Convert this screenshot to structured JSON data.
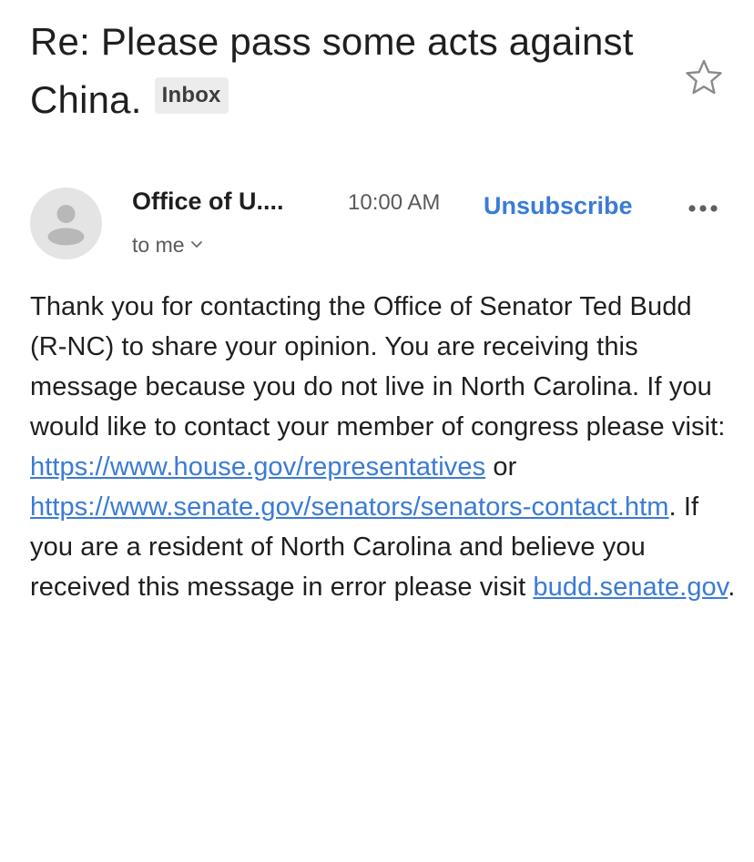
{
  "email": {
    "subject": "Re: Please pass some acts against China.",
    "label": "Inbox",
    "sender": "Office of U....",
    "time": "10:00 AM",
    "unsubscribe": "Unsubscribe",
    "recipient": "to me",
    "body": {
      "part1": "Thank you for contacting the Office of Senator Ted Budd (R-NC) to share your opinion. You are receiving this message because you do not live in North Carolina. If you would like to contact your member of congress please visit: ",
      "link1": "https://www.house.gov/representatives",
      "part2": " or ",
      "link2": "https://www.senate.gov/senators/senators-contact.htm",
      "part3": ". If you are a resident of North Carolina and believe you received this message in error please visit ",
      "link3": "budd.senate.gov",
      "part4": "."
    }
  },
  "icons": {
    "star": "star-outline-icon",
    "avatar": "default-person-avatar",
    "more": "more-horizontal-icon",
    "recipient_toggle": "chevron-down-icon"
  },
  "colors": {
    "link": "#3b7bd5",
    "label_chip_bg": "#ececec",
    "avatar_bg": "#e4e4e4"
  }
}
